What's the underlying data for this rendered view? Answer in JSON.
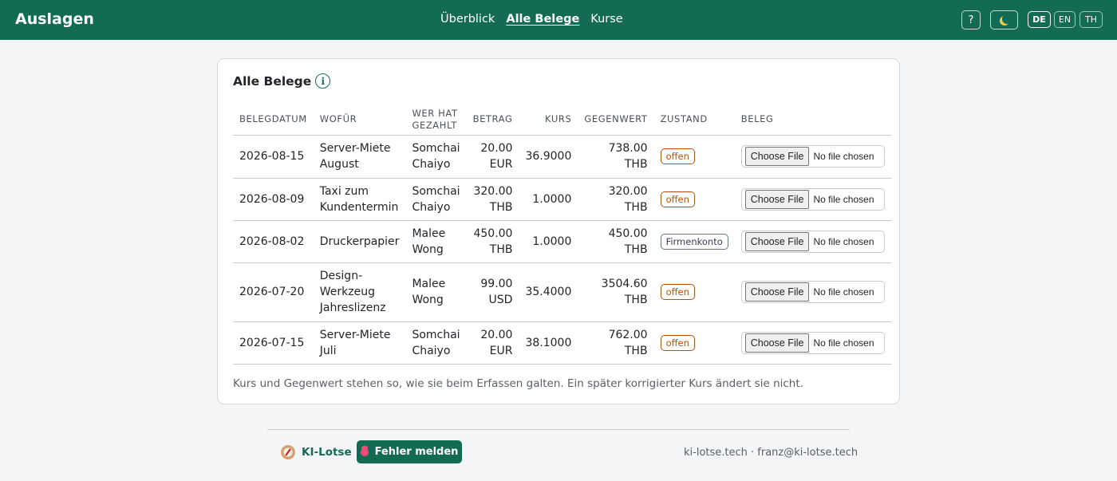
{
  "header": {
    "brand": "Auslagen",
    "nav": [
      "Überblick",
      "Alle Belege",
      "Kurse"
    ],
    "active_nav": "Alle Belege",
    "help_label": "?",
    "languages": [
      "DE",
      "EN",
      "TH"
    ],
    "active_language": "DE",
    "theme_icon": "moon-icon",
    "accent_color": "#136b54"
  },
  "card": {
    "title": "Alle Belege",
    "columns": [
      "BELEGDATUM",
      "WOFÜR",
      "WER HAT GEZAHLT",
      "BETRAG",
      "KURS",
      "GEGENWERT",
      "ZUSTAND",
      "BELEG"
    ],
    "rows": [
      {
        "date": "2026-08-15",
        "what": "Server-Miete August",
        "who": "Somchai Chaiyo",
        "amount": "20.00 EUR",
        "rate": "36.9000",
        "value": "738.00 THB",
        "state": "offen"
      },
      {
        "date": "2026-08-09",
        "what": "Taxi zum Kundentermin",
        "who": "Somchai Chaiyo",
        "amount": "320.00 THB",
        "rate": "1.0000",
        "value": "320.00 THB",
        "state": "offen"
      },
      {
        "date": "2026-08-02",
        "what": "Druckerpapier",
        "who": "Malee Wong",
        "amount": "450.00 THB",
        "rate": "1.0000",
        "value": "450.00 THB",
        "state": "Firmenkonto"
      },
      {
        "date": "2026-07-20",
        "what": "Design-Werkzeug Jahreslizenz",
        "who": "Malee Wong",
        "amount": "99.00 USD",
        "rate": "35.4000",
        "value": "3504.60 THB",
        "state": "offen"
      },
      {
        "date": "2026-07-15",
        "what": "Server-Miete Juli",
        "who": "Somchai Chaiyo",
        "amount": "20.00 EUR",
        "rate": "38.1000",
        "value": "762.00 THB",
        "state": "offen"
      }
    ],
    "file_button": "Choose File",
    "file_status": "No file chosen",
    "note": "Kurs und Gegenwert stehen so, wie sie beim Erfassen galten. Ein später korrigierter Kurs ändert sie nicht."
  },
  "footer": {
    "brand": "KI-Lotse",
    "report_button": "Fehler melden",
    "contact": "ki-lotse.tech · franz@ki-lotse.tech"
  }
}
